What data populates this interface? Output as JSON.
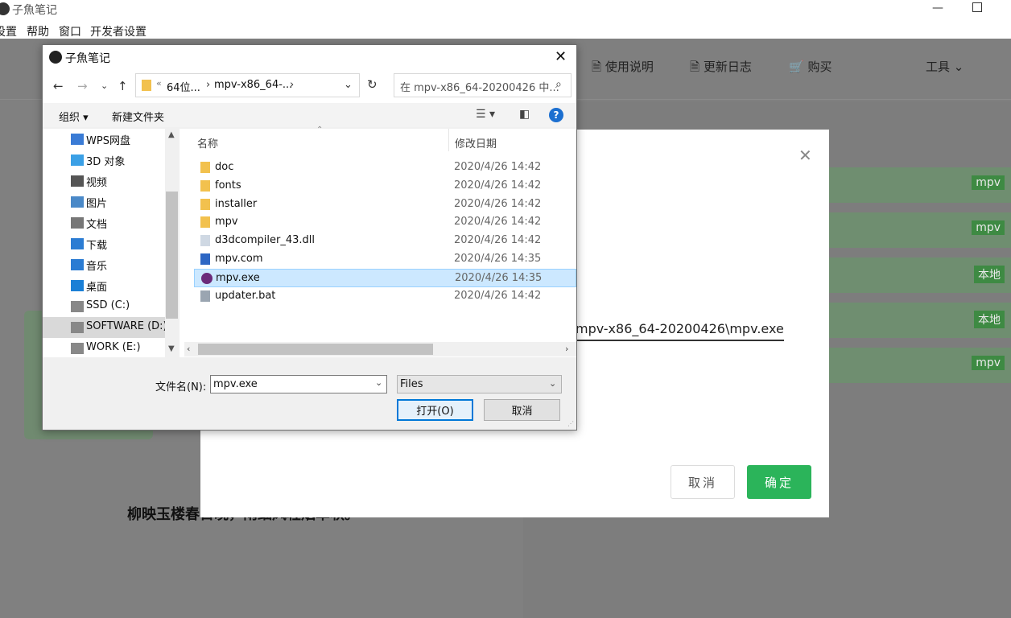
{
  "app": {
    "title": "子魚笔记",
    "minimize_glyph": "—",
    "menu": [
      "设置",
      "帮助",
      "窗口",
      "开发者设置"
    ]
  },
  "nav": {
    "usage": "🗎 使用说明",
    "changelog": "🗎 更新日志",
    "buy": "🛒 购买",
    "tools": "工具 ⌄"
  },
  "list_tags": [
    "mpv",
    "mpv",
    "本地",
    "本地",
    "mpv"
  ],
  "poem": "柳映玉楼春日晚，雨细风轻烟草软。",
  "modal": {
    "close": "✕",
    "path_value": "mpv-x86_64-20200426\\mpv.exe",
    "cancel_label": "取消",
    "ok_label": "确定"
  },
  "dialog": {
    "title": "子魚笔记",
    "close": "✕",
    "address": {
      "sep": "«",
      "crumb1": "64位...",
      "chevron": "›",
      "crumb2": "mpv-x86_64-...",
      "dropdown": "⌄"
    },
    "search_placeholder": "在 mpv-x86_64-20200426 中...",
    "toolbar": {
      "organize": "组织 ▾",
      "new_folder": "新建文件夹",
      "help": "?"
    },
    "nav_tree": [
      {
        "label": "WPS网盘",
        "icon": "cloud-icon",
        "color": "#3a7bd5"
      },
      {
        "label": "3D 对象",
        "icon": "cube-icon",
        "color": "#3ba0e6"
      },
      {
        "label": "视频",
        "icon": "video-icon",
        "color": "#555555"
      },
      {
        "label": "图片",
        "icon": "picture-icon",
        "color": "#4a89c8"
      },
      {
        "label": "文档",
        "icon": "document-icon",
        "color": "#777777"
      },
      {
        "label": "下载",
        "icon": "download-icon",
        "color": "#2b7cd3"
      },
      {
        "label": "音乐",
        "icon": "music-icon",
        "color": "#2b7cd3"
      },
      {
        "label": "桌面",
        "icon": "desktop-icon",
        "color": "#1a7fd6"
      },
      {
        "label": "SSD (C:)",
        "icon": "drive-icon",
        "color": "#888888"
      },
      {
        "label": "SOFTWARE (D:)",
        "icon": "drive-icon",
        "color": "#888888",
        "selected": true
      },
      {
        "label": "WORK (E:)",
        "icon": "drive-icon",
        "color": "#888888"
      }
    ],
    "columns": {
      "name": "名称",
      "date": "修改日期"
    },
    "files": [
      {
        "name": "doc",
        "date": "2020/4/26 14:42",
        "icon": "folder-icon",
        "color": "#f2c14e"
      },
      {
        "name": "fonts",
        "date": "2020/4/26 14:42",
        "icon": "folder-icon",
        "color": "#f2c14e"
      },
      {
        "name": "installer",
        "date": "2020/4/26 14:42",
        "icon": "folder-icon",
        "color": "#f2c14e"
      },
      {
        "name": "mpv",
        "date": "2020/4/26 14:42",
        "icon": "folder-icon",
        "color": "#f2c14e"
      },
      {
        "name": "d3dcompiler_43.dll",
        "date": "2020/4/26 14:42",
        "icon": "dll-file-icon",
        "color": "#cfd8e3"
      },
      {
        "name": "mpv.com",
        "date": "2020/4/26 14:35",
        "icon": "com-file-icon",
        "color": "#2d66c4"
      },
      {
        "name": "mpv.exe",
        "date": "2020/4/26 14:35",
        "icon": "mpv-app-icon",
        "color": "#6b2a7a",
        "selected": true
      },
      {
        "name": "updater.bat",
        "date": "2020/4/26 14:42",
        "icon": "bat-file-icon",
        "color": "#9aa5b1"
      }
    ],
    "filename_label": "文件名(N):",
    "filename_value": "mpv.exe",
    "filetype_value": "Files",
    "open_label": "打开(O)",
    "cancel_label": "取消"
  }
}
